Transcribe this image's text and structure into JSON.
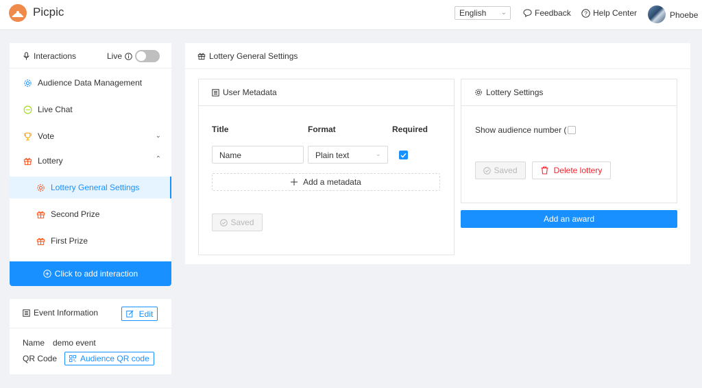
{
  "app": {
    "name": "Picpic"
  },
  "header": {
    "language": "English",
    "feedback": "Feedback",
    "help": "Help Center",
    "user": "Phoebe"
  },
  "sidebar": {
    "title": "Interactions",
    "live_label": "Live",
    "live_on": false,
    "items": [
      {
        "label": "Audience Data Management",
        "icon": "gear-icon"
      },
      {
        "label": "Live Chat",
        "icon": "chat-icon"
      },
      {
        "label": "Vote",
        "icon": "trophy-icon",
        "expanded": false
      },
      {
        "label": "Lottery",
        "icon": "gift-icon",
        "expanded": true
      },
      {
        "label": "Lottery General Settings",
        "icon": "gear-icon",
        "active": true
      },
      {
        "label": "Second Prize",
        "icon": "gift-icon"
      },
      {
        "label": "First Prize",
        "icon": "gift-icon"
      }
    ],
    "add_button": "Click to add interaction"
  },
  "event": {
    "title": "Event Information",
    "edit": "Edit",
    "name_label": "Name",
    "name_value": "demo event",
    "qr_label": "QR Code",
    "qr_button": "Audience QR code"
  },
  "main": {
    "title": "Lottery General Settings",
    "metadata": {
      "title": "User Metadata",
      "columns": [
        "Title",
        "Format",
        "Required"
      ],
      "rows": [
        {
          "title": "Name",
          "format": "Plain text",
          "required": true
        }
      ],
      "add_label": "Add a metadata",
      "saved": "Saved"
    },
    "lottery": {
      "title": "Lottery Settings",
      "show_audience": "Show audience number (",
      "show_audience_checked": false,
      "saved": "Saved",
      "delete": "Delete lottery"
    },
    "add_award": "Add an award"
  },
  "colors": {
    "primary": "#1890ff",
    "danger": "#f5222d",
    "brand": "#f08a4b"
  }
}
